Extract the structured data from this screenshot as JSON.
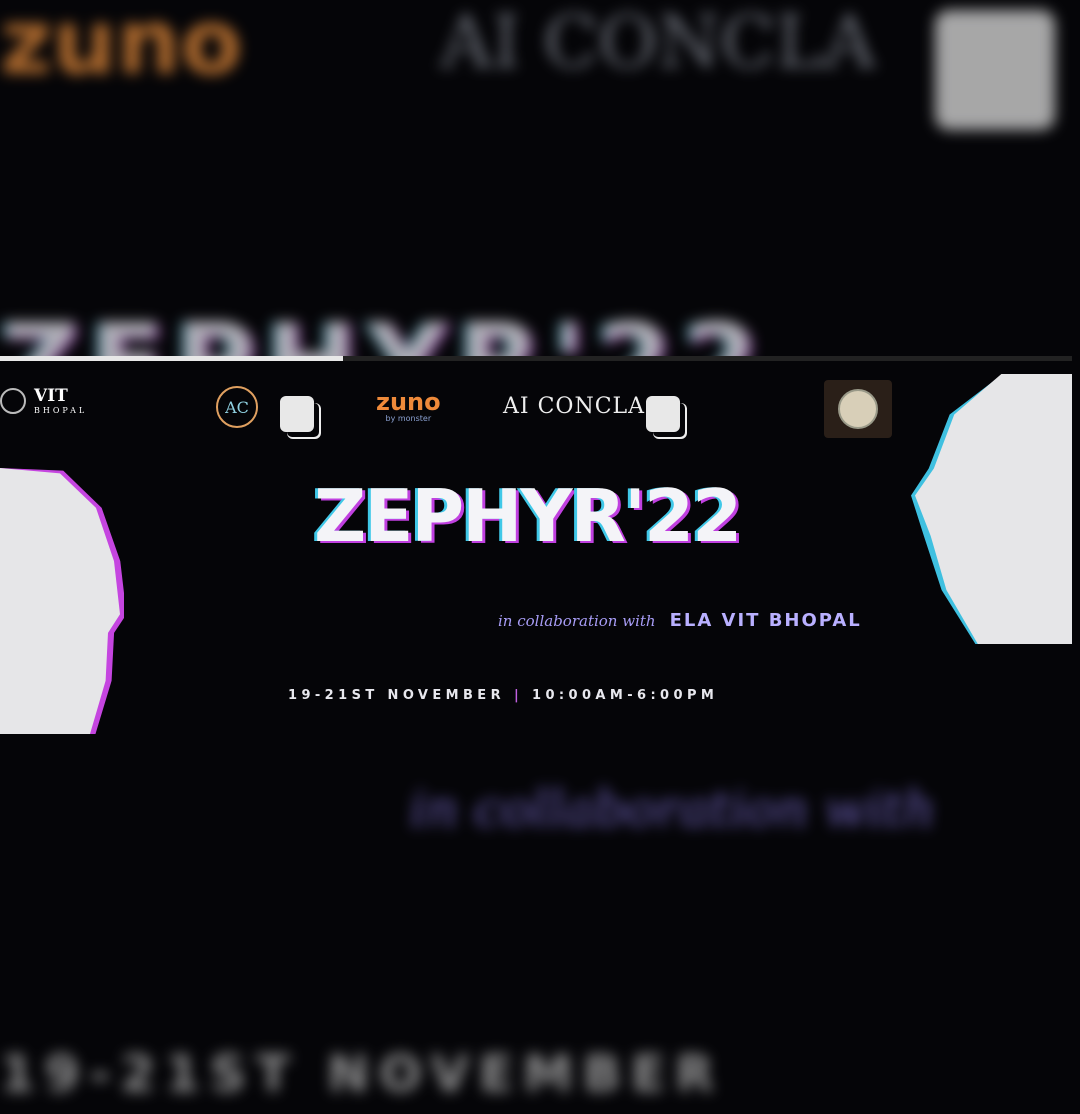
{
  "story_progress_percent": 32,
  "logos": {
    "vit": {
      "name": "VIT",
      "sub": "BHOPAL"
    },
    "alc": "AC",
    "zuno": {
      "name": "zuno",
      "sub": "by monster"
    },
    "ai_conclave": "AI CONCLA"
  },
  "poster": {
    "title": "ZEPHYR'22",
    "collab_script": "in collaboration with",
    "collab_org": "ELA VIT BHOPAL",
    "dates": "19-21ST NOVEMBER",
    "separator": "|",
    "time": "10:00AM-6:00PM"
  },
  "colors": {
    "accent_cyan": "#40c8e8",
    "accent_magenta": "#c040e0",
    "collab_purple": "#b9b0ff",
    "background": "#050508"
  }
}
